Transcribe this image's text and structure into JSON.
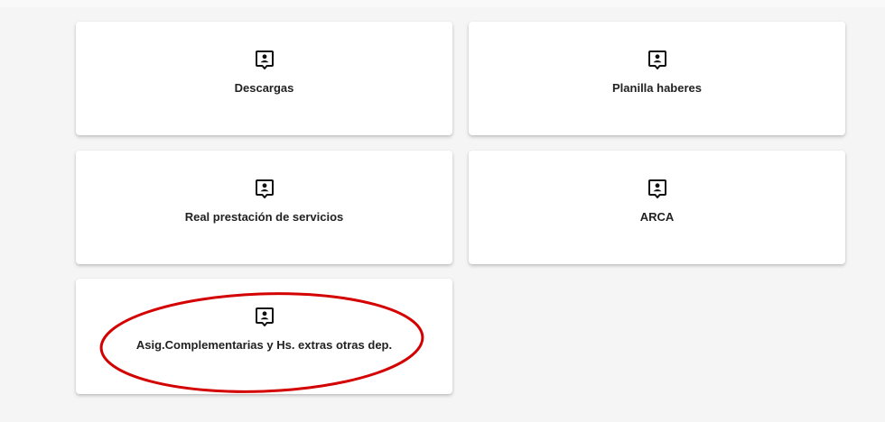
{
  "cards": [
    {
      "label": "Descargas",
      "icon": "contact-badge-icon"
    },
    {
      "label": "Planilla haberes",
      "icon": "contact-badge-icon"
    },
    {
      "label": "Real prestación de servicios",
      "icon": "contact-badge-icon"
    },
    {
      "label": "ARCA",
      "icon": "contact-badge-icon"
    },
    {
      "label": "Asig.Complementarias y Hs. extras otras dep.",
      "icon": "contact-badge-icon"
    }
  ],
  "colors": {
    "background": "#f5f5f5",
    "card": "#ffffff",
    "text": "#222222",
    "annotation": "#d40000"
  }
}
